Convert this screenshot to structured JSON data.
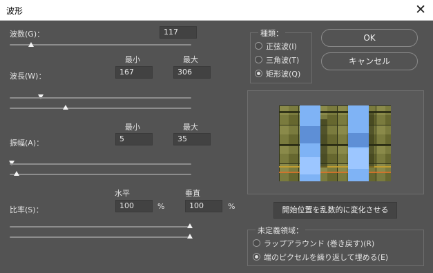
{
  "window": {
    "title": "波形"
  },
  "wavelength": {
    "label": "波数(G)：",
    "value": "117"
  },
  "wavelen": {
    "label": "波長(W)：",
    "min_header": "最小",
    "max_header": "最大",
    "min_value": "167",
    "max_value": "306"
  },
  "amplitude": {
    "label": "振幅(A)：",
    "min_header": "最小",
    "max_header": "最大",
    "min_value": "5",
    "max_value": "35"
  },
  "scale": {
    "label": "比率(S)：",
    "horizontal_header": "水平",
    "vertical_header": "垂直",
    "horizontal_value": "100",
    "vertical_value": "100",
    "unit": "%"
  },
  "type_group": {
    "legend": "種類：",
    "options": [
      "正弦波(I)",
      "三角波(T)",
      "矩形波(Q)"
    ],
    "selected_index": 2
  },
  "buttons": {
    "ok": "OK",
    "cancel": "キャンセル",
    "randomize": "開始位置を乱数的に変化させる"
  },
  "undefined_area": {
    "legend": "未定義領域：",
    "options": [
      "ラップアラウンド (巻き戻す)(R)",
      "端のピクセルを繰り返して埋める(E)"
    ],
    "selected_index": 1
  },
  "colors": {
    "dialog_bg": "#535353",
    "field_bg": "#424242",
    "title_bg": "#ffffff",
    "accent": "#8fb8ff"
  }
}
